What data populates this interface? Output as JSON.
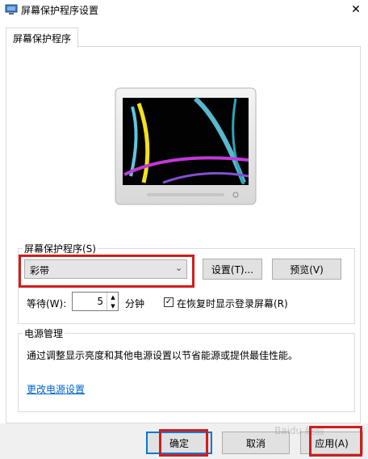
{
  "window": {
    "title": "屏幕保护程序设置",
    "close_glyph": "✕"
  },
  "tabs": [
    {
      "label": "屏幕保护程序",
      "active": true
    }
  ],
  "screensaver": {
    "group_label": "屏幕保护程序(S)",
    "selected": "彩带",
    "dropdown_glyph": "⌄",
    "settings_button": "设置(T)...",
    "preview_button": "预览(V)",
    "wait_label": "等待(W):",
    "wait_value": "5",
    "spin_up_glyph": "▲",
    "spin_down_glyph": "▼",
    "wait_unit": "分钟",
    "resume_checkbox_label": "在恢复时显示登录屏幕(R)",
    "resume_checked": true,
    "check_glyph": "✓"
  },
  "power": {
    "group_label": "电源管理",
    "description": "通过调整显示亮度和其他电源设置以节省能源或提供最佳性能。",
    "link_text": "更改电源设置"
  },
  "footer": {
    "ok_label": "确定",
    "cancel_label": "取消",
    "apply_label": "应用(A)"
  },
  "watermark": "Baidu 经验",
  "colors": {
    "accent": "#0078d7",
    "highlight": "#d21c1c",
    "link": "#0066cc"
  }
}
